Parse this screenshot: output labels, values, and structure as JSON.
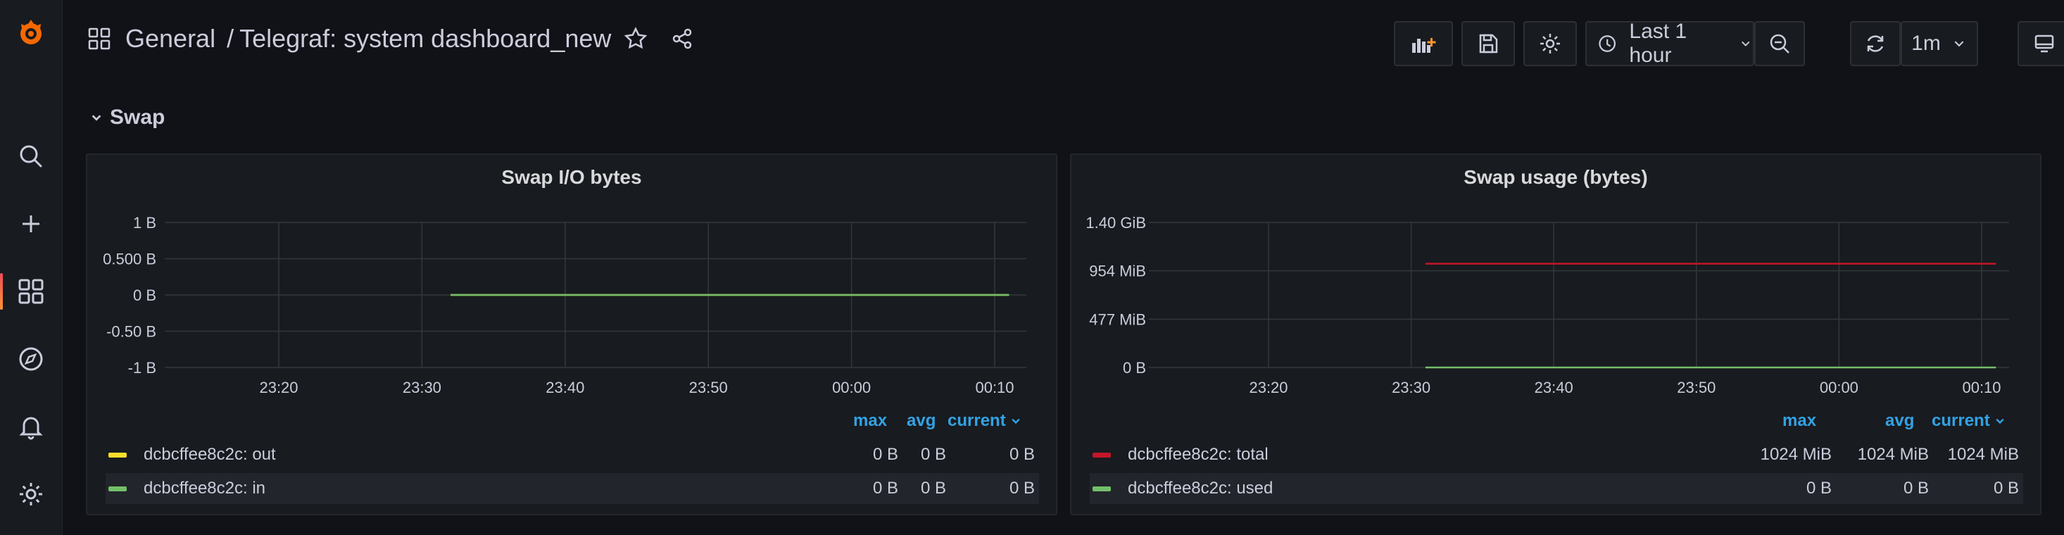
{
  "breadcrumb": {
    "folder": "General",
    "separator": "/",
    "dashboard": "Telegraf: system dashboard_new"
  },
  "toolbar": {
    "time_range": "Last 1 hour",
    "refresh_interval": "1m"
  },
  "row": {
    "title": "Swap"
  },
  "panels": [
    {
      "title": "Swap I/O bytes",
      "legend_headers": {
        "max": "max",
        "avg": "avg",
        "current": "current"
      },
      "legend": [
        {
          "name": "dcbcffee8c2c: out",
          "color": "#fade2a",
          "max": "0 B",
          "avg": "0 B",
          "current": "0 B"
        },
        {
          "name": "dcbcffee8c2c: in",
          "color": "#73bf69",
          "max": "0 B",
          "avg": "0 B",
          "current": "0 B"
        }
      ]
    },
    {
      "title": "Swap usage (bytes)",
      "legend_headers": {
        "max": "max",
        "avg": "avg",
        "current": "current"
      },
      "legend": [
        {
          "name": "dcbcffee8c2c: total",
          "color": "#c4162a",
          "max": "1024 MiB",
          "avg": "1024 MiB",
          "current": "1024 MiB"
        },
        {
          "name": "dcbcffee8c2c: used",
          "color": "#73bf69",
          "max": "0 B",
          "avg": "0 B",
          "current": "0 B"
        }
      ]
    }
  ],
  "chart_data": [
    {
      "type": "line",
      "title": "Swap I/O bytes",
      "x_ticks": [
        "23:20",
        "23:30",
        "23:40",
        "23:50",
        "00:00",
        "00:10"
      ],
      "y_ticks": [
        "1 B",
        "0.500 B",
        "0 B",
        "-0.50 B",
        "-1 B"
      ],
      "ylim": [
        -1,
        1
      ],
      "series": [
        {
          "name": "dcbcffee8c2c: out",
          "color": "#fade2a",
          "x": [
            "23:32",
            "00:11"
          ],
          "values": [
            0,
            0
          ]
        },
        {
          "name": "dcbcffee8c2c: in",
          "color": "#73bf69",
          "x": [
            "23:32",
            "00:11"
          ],
          "values": [
            0,
            0
          ]
        }
      ]
    },
    {
      "type": "line",
      "title": "Swap usage (bytes)",
      "x_ticks": [
        "23:20",
        "23:30",
        "23:40",
        "23:50",
        "00:00",
        "00:10"
      ],
      "y_ticks": [
        "1.40 GiB",
        "954 MiB",
        "477 MiB",
        "0 B"
      ],
      "ylim_mib": [
        0,
        1431
      ],
      "series": [
        {
          "name": "dcbcffee8c2c: total",
          "color": "#c4162a",
          "x": [
            "23:31",
            "00:11"
          ],
          "values_mib": [
            1024,
            1024
          ]
        },
        {
          "name": "dcbcffee8c2c: used",
          "color": "#73bf69",
          "x": [
            "23:31",
            "00:11"
          ],
          "values_mib": [
            0,
            0
          ]
        }
      ]
    }
  ]
}
